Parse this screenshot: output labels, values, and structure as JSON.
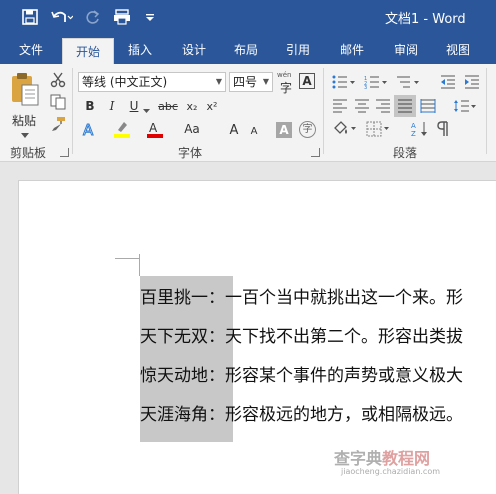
{
  "window": {
    "title": "文档1 - Word"
  },
  "qat": {
    "customize_icon": "dropdown-arrow-icon"
  },
  "tabs": [
    {
      "label": "文件"
    },
    {
      "label": "开始"
    },
    {
      "label": "插入"
    },
    {
      "label": "设计"
    },
    {
      "label": "布局"
    },
    {
      "label": "引用"
    },
    {
      "label": "邮件"
    },
    {
      "label": "审阅"
    },
    {
      "label": "视图"
    }
  ],
  "active_tab": "开始",
  "clipboard": {
    "paste_label": "粘贴",
    "group_label": "剪贴板"
  },
  "font": {
    "name": "等线 (中文正文)",
    "size": "四号",
    "group_label": "字体",
    "wen_label": "wén",
    "grow_label": "A",
    "shrink_label": "A",
    "case_label": "Aa",
    "shade_label": "A",
    "circle_label": "字"
  },
  "format_buttons": {
    "bold": "B",
    "italic": "I",
    "underline": "U",
    "strike": "abc",
    "subscript": "x₂",
    "superscript": "x²"
  },
  "colors": {
    "accent": "#2b579a",
    "highlight": "#ffff00",
    "font_color": "#e00000",
    "selection": "#c8c8c8"
  },
  "paragraph": {
    "group_label": "段落"
  },
  "document": {
    "lines": [
      {
        "term": "百里挑一",
        "sep": "：",
        "text": "一百个当中就挑出这一个来。形"
      },
      {
        "term": "天下无双",
        "sep": "：",
        "text": "天下找不出第二个。形容出类拔"
      },
      {
        "term": "惊天动地",
        "sep": "：",
        "text": "形容某个事件的声势或意义极大"
      },
      {
        "term": "天涯海角",
        "sep": "：",
        "text": "形容极远的地方，或相隔极远。"
      }
    ]
  },
  "watermark": {
    "line1": "查字典",
    "line2": "教程网",
    "line3": "jiaocheng.chazidian.com"
  }
}
